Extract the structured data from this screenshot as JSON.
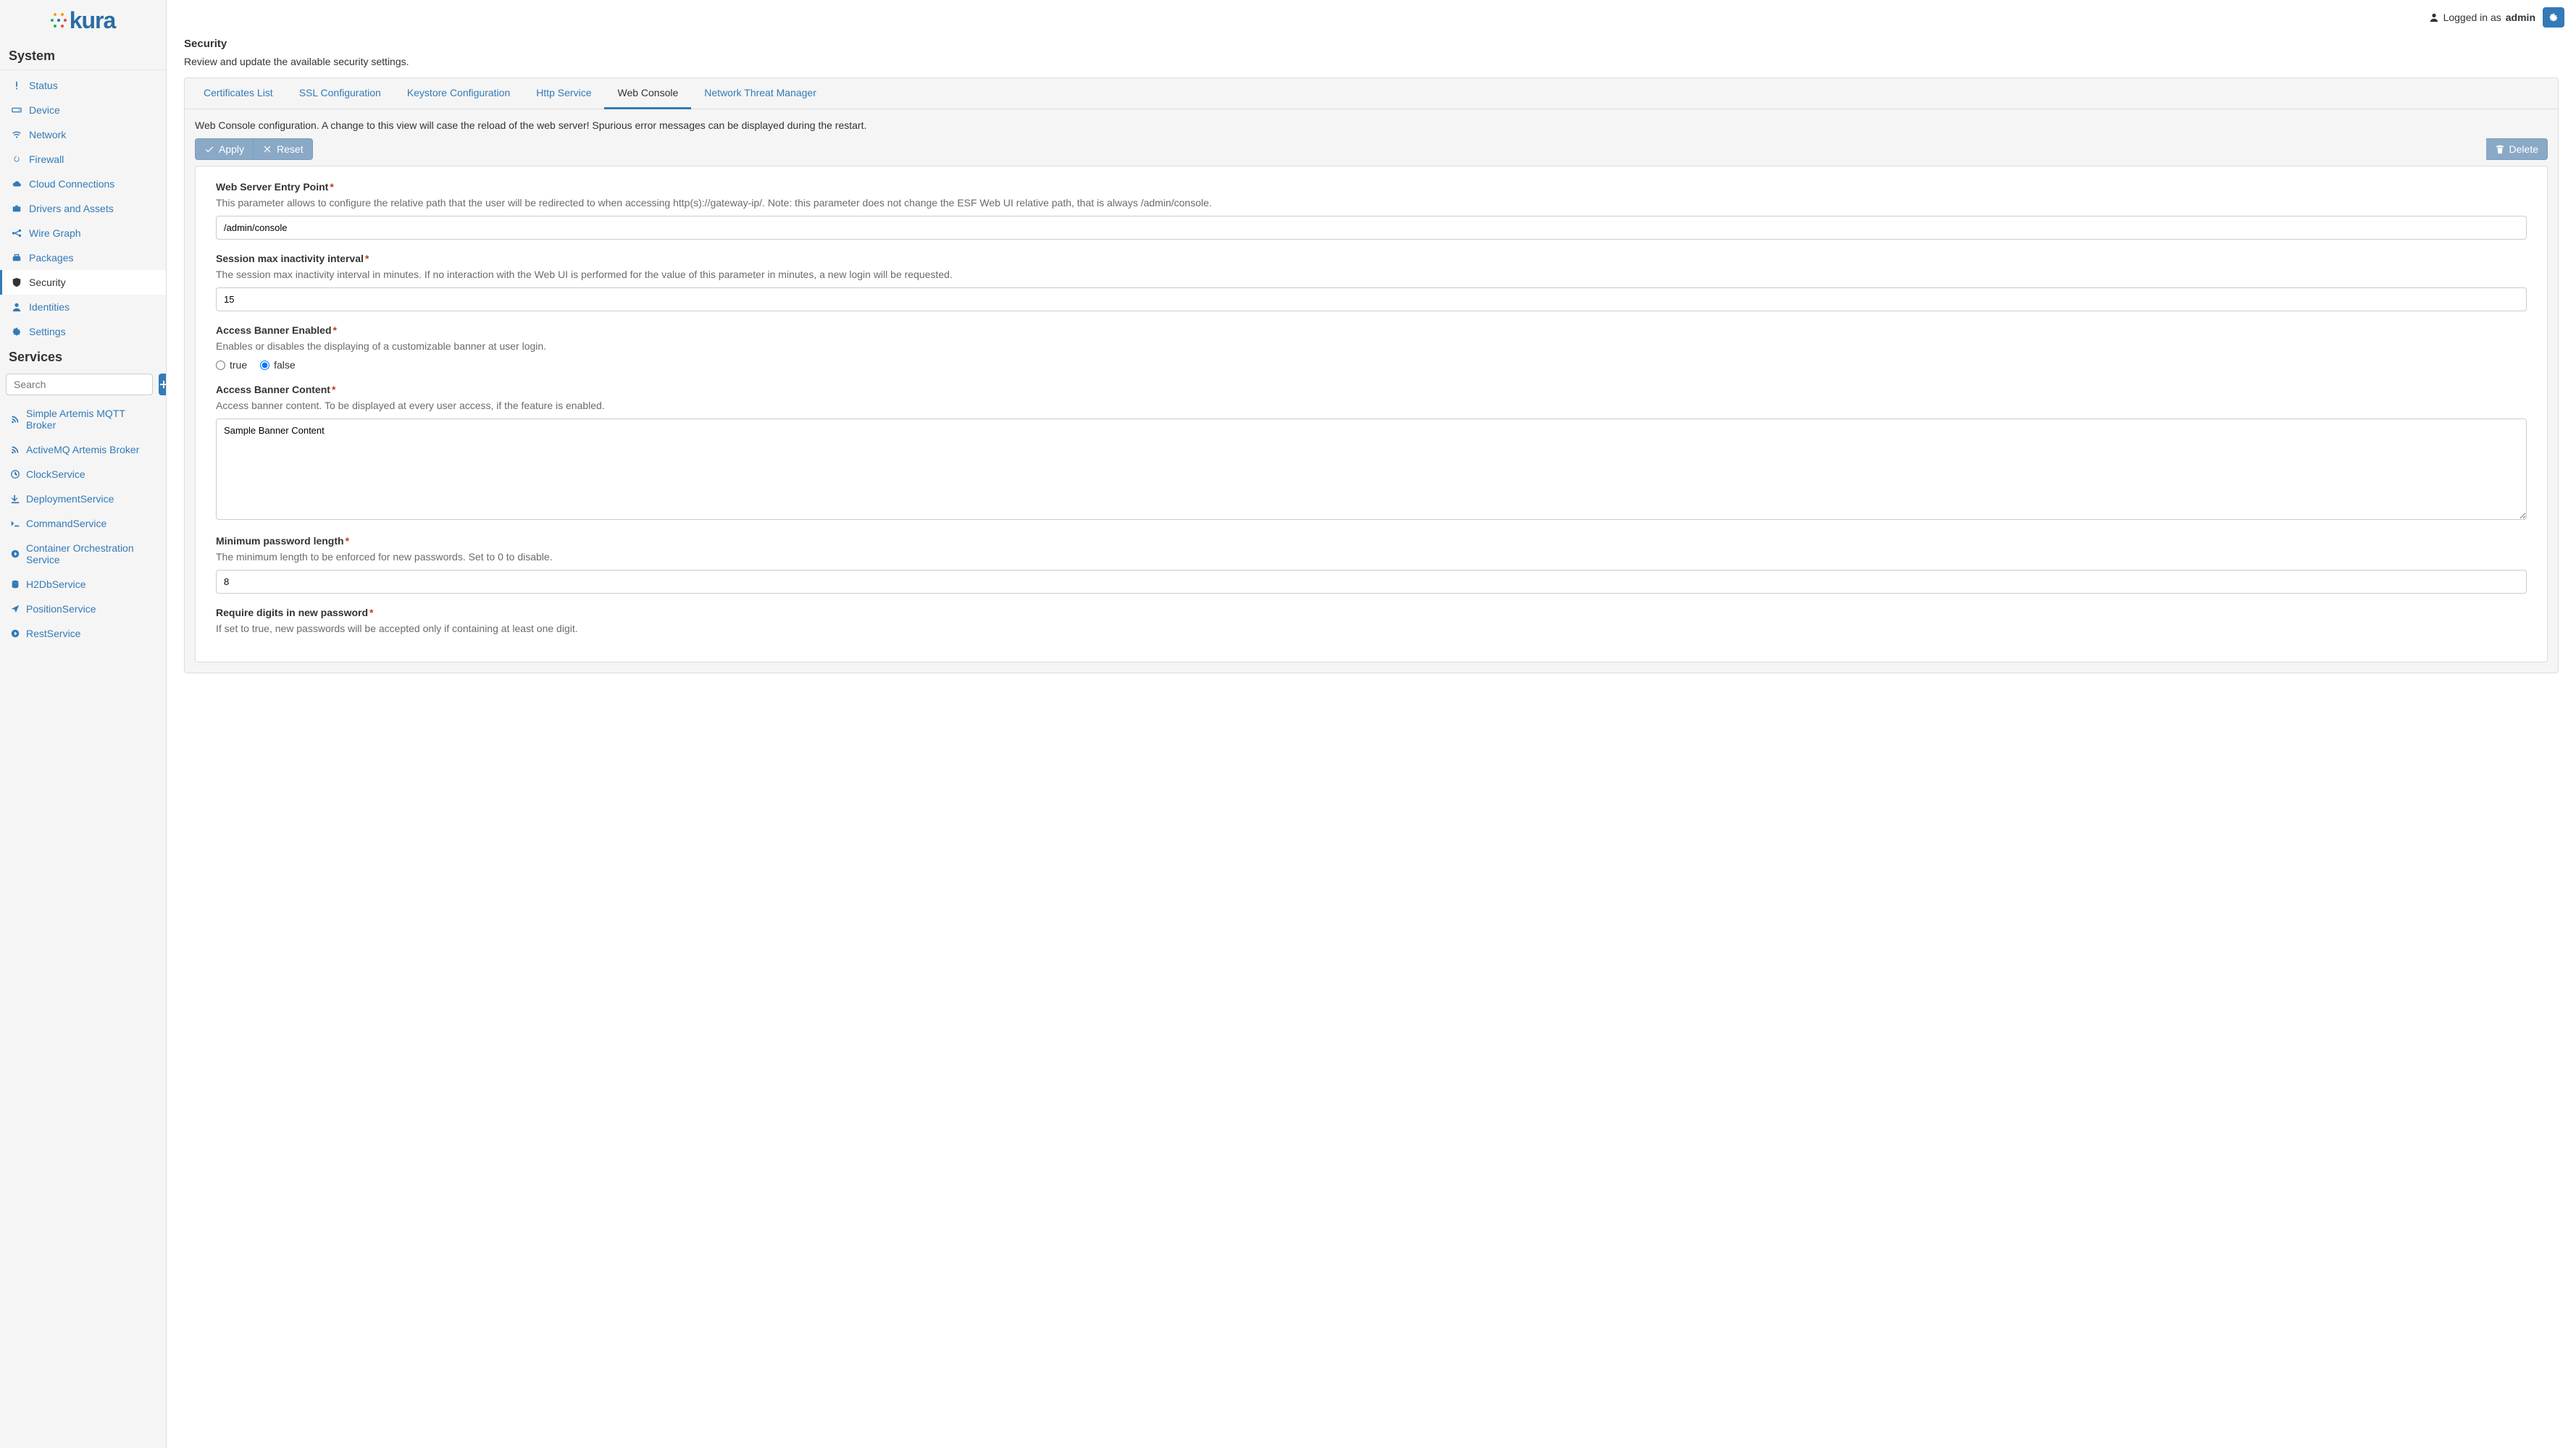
{
  "brand": "kura",
  "header": {
    "logged_in_as": "Logged in as",
    "username": "admin"
  },
  "sidebar": {
    "section_system": "System",
    "section_services": "Services",
    "search_placeholder": "Search",
    "items": [
      {
        "label": "Status",
        "icon": "exclaim"
      },
      {
        "label": "Device",
        "icon": "hdd"
      },
      {
        "label": "Network",
        "icon": "wifi"
      },
      {
        "label": "Firewall",
        "icon": "fire"
      },
      {
        "label": "Cloud Connections",
        "icon": "cloud"
      },
      {
        "label": "Drivers and Assets",
        "icon": "briefcase"
      },
      {
        "label": "Wire Graph",
        "icon": "graph"
      },
      {
        "label": "Packages",
        "icon": "toolbox"
      },
      {
        "label": "Security",
        "icon": "shield"
      },
      {
        "label": "Identities",
        "icon": "user"
      },
      {
        "label": "Settings",
        "icon": "gear"
      }
    ],
    "services": [
      {
        "label": "Simple Artemis MQTT Broker",
        "icon": "rss"
      },
      {
        "label": "ActiveMQ Artemis Broker",
        "icon": "rss"
      },
      {
        "label": "ClockService",
        "icon": "clock"
      },
      {
        "label": "DeploymentService",
        "icon": "download"
      },
      {
        "label": "CommandService",
        "icon": "terminal"
      },
      {
        "label": "Container Orchestration Service",
        "icon": "circleright"
      },
      {
        "label": "H2DbService",
        "icon": "db"
      },
      {
        "label": "PositionService",
        "icon": "location"
      },
      {
        "label": "RestService",
        "icon": "circleright"
      }
    ]
  },
  "page": {
    "title": "Security",
    "desc": "Review and update the available security settings.",
    "tabs": [
      "Certificates List",
      "SSL Configuration",
      "Keystore Configuration",
      "Http Service",
      "Web Console",
      "Network Threat Manager"
    ],
    "tab_desc": "Web Console configuration. A change to this view will case the reload of the web server! Spurious error messages can be displayed during the restart.",
    "apply": "Apply",
    "reset": "Reset",
    "delete": "Delete",
    "fields": {
      "entry": {
        "label": "Web Server Entry Point",
        "help": "This parameter allows to configure the relative path that the user will be redirected to when accessing http(s)://gateway-ip/. Note: this parameter does not change the ESF Web UI relative path, that is always /admin/console.",
        "value": "/admin/console"
      },
      "inactivity": {
        "label": "Session max inactivity interval",
        "help": "The session max inactivity interval in minutes. If no interaction with the Web UI is performed for the value of this parameter in minutes, a new login will be requested.",
        "value": "15"
      },
      "banner_enabled": {
        "label": "Access Banner Enabled",
        "help": "Enables or disables the displaying of a customizable banner at user login.",
        "opt_true": "true",
        "opt_false": "false",
        "value": "false"
      },
      "banner_content": {
        "label": "Access Banner Content",
        "help": "Access banner content. To be displayed at every user access, if the feature is enabled.",
        "value": "Sample Banner Content"
      },
      "min_pwd": {
        "label": "Minimum password length",
        "help": "The minimum length to be enforced for new passwords. Set to 0 to disable.",
        "value": "8"
      },
      "req_digits": {
        "label": "Require digits in new password",
        "help": "If set to true, new passwords will be accepted only if containing at least one digit."
      }
    }
  }
}
